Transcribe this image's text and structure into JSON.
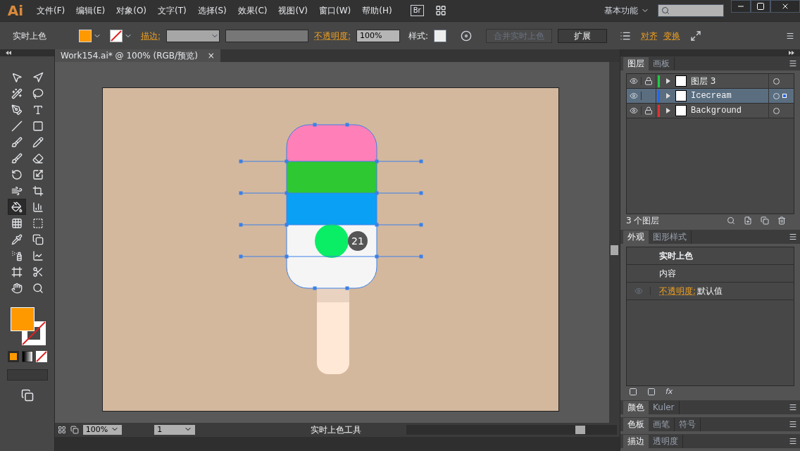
{
  "app": {
    "logo": "Ai",
    "menu": [
      "文件(F)",
      "编辑(E)",
      "对象(O)",
      "文字(T)",
      "选择(S)",
      "效果(C)",
      "视图(V)",
      "窗口(W)",
      "帮助(H)"
    ],
    "bridge": "Br",
    "workspace": "基本功能"
  },
  "control_bar": {
    "tool_label": "实时上色",
    "stroke_label": "描边:",
    "opacity_label": "不透明度:",
    "opacity_value": "100%",
    "style_label": "样式:",
    "merge_button": "合并实时上色",
    "merge_disabled": true,
    "expand_button": "扩展",
    "align_link": "对齐",
    "transform_link": "变换"
  },
  "document_tab": {
    "title": "Work154.ai* @ 100% (RGB/预览)",
    "close": "×"
  },
  "tools": [
    {
      "kind": "selection",
      "selected": false
    },
    {
      "kind": "direct",
      "selected": false
    },
    {
      "kind": "wand",
      "selected": false
    },
    {
      "kind": "lasso",
      "selected": false
    },
    {
      "kind": "pen",
      "selected": false
    },
    {
      "kind": "type",
      "selected": false
    },
    {
      "kind": "line",
      "selected": false
    },
    {
      "kind": "rect",
      "selected": false
    },
    {
      "kind": "brush",
      "selected": false
    },
    {
      "kind": "pencil",
      "selected": false
    },
    {
      "kind": "blob",
      "selected": false
    },
    {
      "kind": "eraser",
      "selected": false
    },
    {
      "kind": "rotate",
      "selected": false
    },
    {
      "kind": "scale",
      "selected": false
    },
    {
      "kind": "warp",
      "selected": false
    },
    {
      "kind": "freetransform",
      "selected": false
    },
    {
      "kind": "livepaint",
      "selected": true
    },
    {
      "kind": "graph",
      "selected": false
    },
    {
      "kind": "mesh",
      "selected": false
    },
    {
      "kind": "gradient",
      "selected": false
    },
    {
      "kind": "eyedropper",
      "selected": false
    },
    {
      "kind": "blend",
      "selected": false
    },
    {
      "kind": "spray",
      "selected": false
    },
    {
      "kind": "column",
      "selected": false
    },
    {
      "kind": "artboard",
      "selected": false
    },
    {
      "kind": "slice",
      "selected": false
    },
    {
      "kind": "hand",
      "selected": false
    },
    {
      "kind": "zoom",
      "selected": false
    }
  ],
  "canvas": {
    "badge": "21"
  },
  "layers_panel": {
    "tabs": [
      {
        "label": "图层",
        "selected": true
      },
      {
        "label": "画板",
        "selected": false
      }
    ],
    "layers": [
      {
        "name": "图层 3",
        "color": "#22cc44",
        "locked": true,
        "selected": false,
        "mono": false
      },
      {
        "name": "Icecream",
        "color": "#2266ee",
        "locked": false,
        "selected": true,
        "mono": true
      },
      {
        "name": "Background",
        "color": "#dd3333",
        "locked": true,
        "selected": false,
        "mono": true
      }
    ],
    "count": "3 个图层"
  },
  "appearance_panel": {
    "tabs": [
      {
        "label": "外观",
        "selected": true
      },
      {
        "label": "图形样式",
        "selected": false
      }
    ],
    "title": "实时上色",
    "content": "内容",
    "fx_label": "fx",
    "opacity_label": "不透明度:",
    "opacity_value": "默认值"
  },
  "collapsed_panels": [
    {
      "tabs": [
        {
          "label": "颜色",
          "selected": true
        },
        {
          "label": "Kuler",
          "selected": false
        }
      ]
    },
    {
      "tabs": [
        {
          "label": "色板",
          "selected": true
        },
        {
          "label": "画笔",
          "selected": false
        },
        {
          "label": "符号",
          "selected": false
        }
      ]
    },
    {
      "tabs": [
        {
          "label": "描边",
          "selected": true
        },
        {
          "label": "透明度",
          "selected": false
        }
      ]
    }
  ],
  "status_bar": {
    "zoom": "100%",
    "artboard": "1",
    "tool": "实时上色工具"
  }
}
